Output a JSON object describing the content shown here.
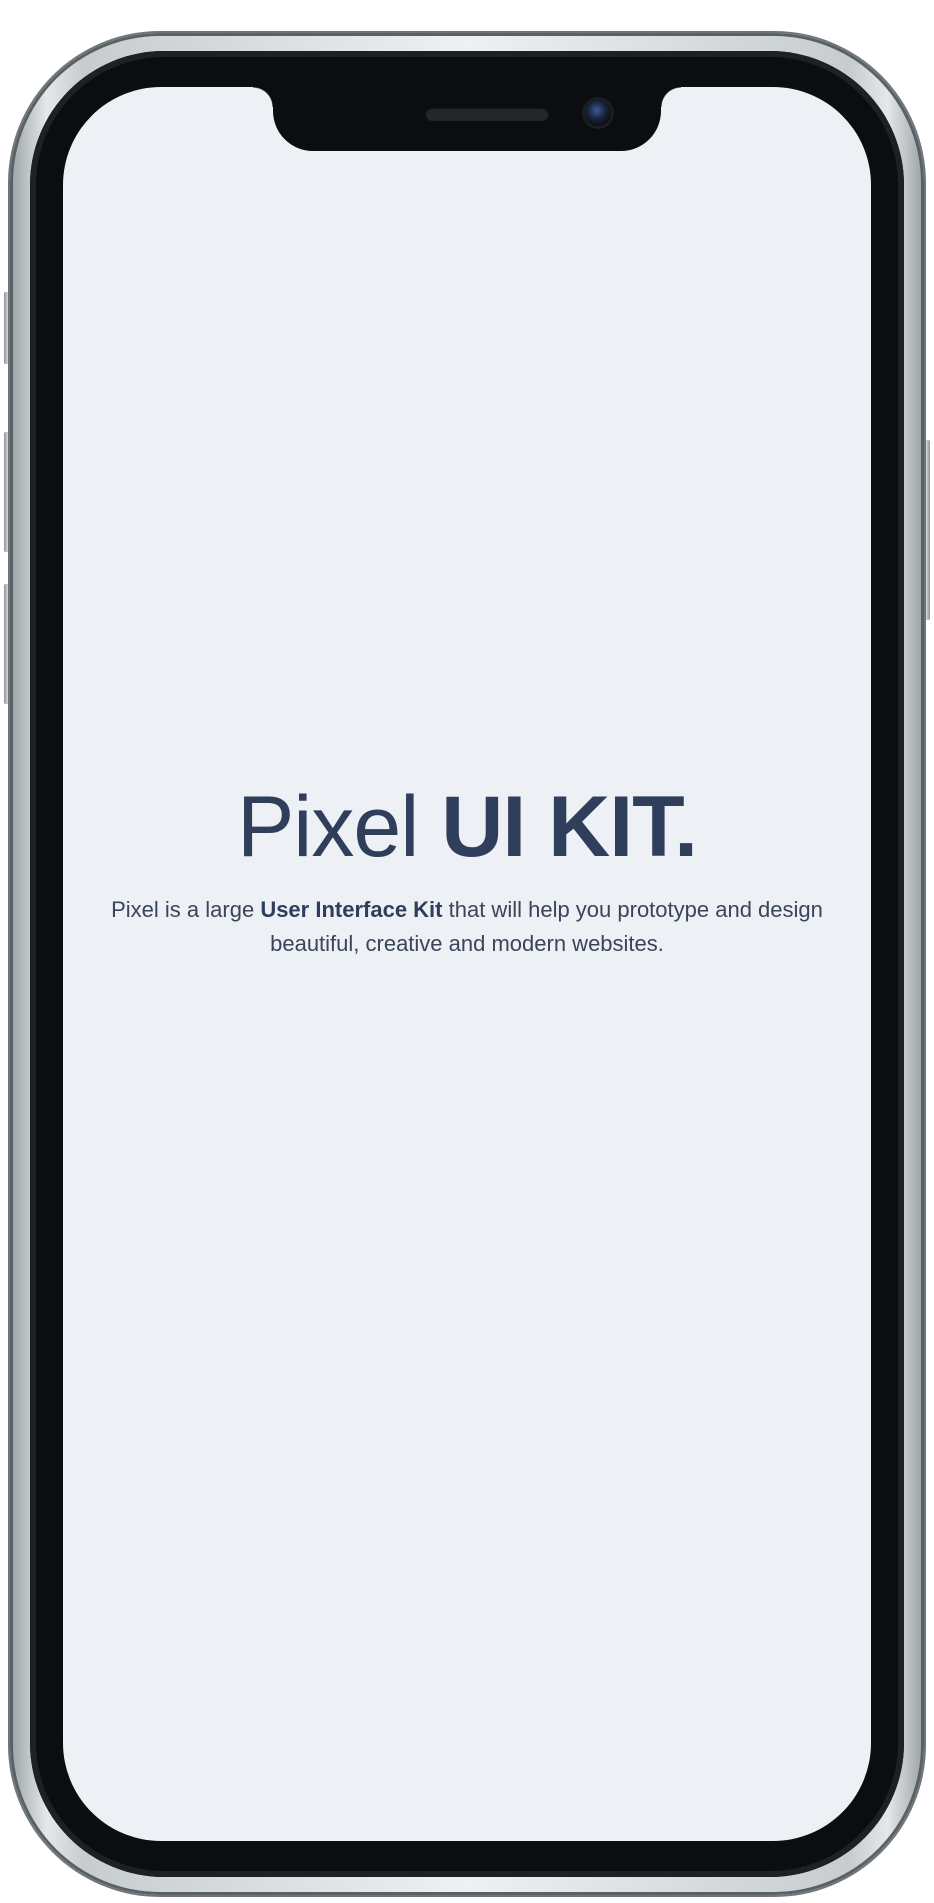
{
  "screen": {
    "background": "#edf0f4",
    "text_color": "#2f3e5b"
  },
  "hero": {
    "title_light": "Pixel",
    "title_bold": "UI KIT.",
    "lead_prefix": "Pixel is a large",
    "lead_strong": "User Interface Kit",
    "lead_suffix": "that will help you prototype and design beautiful, creative and modern websites."
  }
}
